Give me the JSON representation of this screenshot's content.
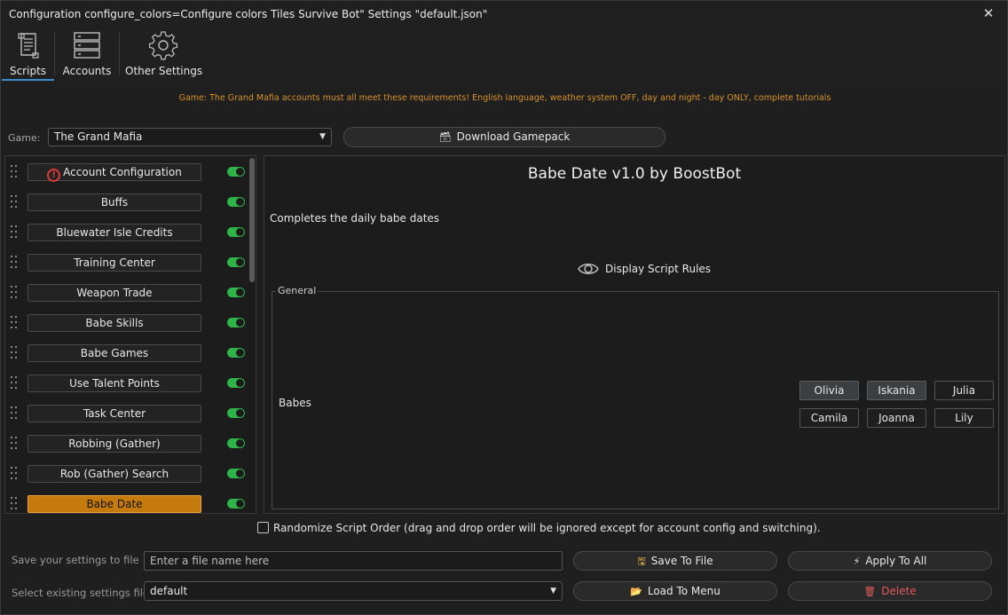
{
  "window": {
    "title": "Configuration configure_colors=Configure colors Tiles Survive Bot\" Settings \"default.json\"",
    "close_icon": "close-icon"
  },
  "toolbar": {
    "tabs": [
      {
        "label": "Scripts",
        "icon": "scroll-icon",
        "active": true
      },
      {
        "label": "Accounts",
        "icon": "server-rack-icon",
        "active": false
      },
      {
        "label": "Other Settings",
        "icon": "gear-icon",
        "active": false
      }
    ]
  },
  "notice": "Game: The Grand Mafia accounts must all meet these requirements! English language, weather system OFF, day and night - day ONLY, complete tutorials",
  "game": {
    "label": "Game:",
    "selected": "The Grand Mafia",
    "download_label": "Download Gamepack"
  },
  "scripts": {
    "items": [
      {
        "label": "Account Configuration",
        "enabled": true,
        "warning": true
      },
      {
        "label": "Buffs",
        "enabled": true
      },
      {
        "label": "Bluewater Isle Credits",
        "enabled": true
      },
      {
        "label": "Training Center",
        "enabled": true
      },
      {
        "label": "Weapon Trade",
        "enabled": true
      },
      {
        "label": "Babe Skills",
        "enabled": true
      },
      {
        "label": "Babe Games",
        "enabled": true
      },
      {
        "label": "Use Talent Points",
        "enabled": true
      },
      {
        "label": "Task Center",
        "enabled": true
      },
      {
        "label": "Robbing (Gather)",
        "enabled": true
      },
      {
        "label": "Rob (Gather) Search",
        "enabled": true
      },
      {
        "label": "Babe Date",
        "enabled": true,
        "selected": true
      }
    ]
  },
  "detail": {
    "title": "Babe Date v1.0 by BoostBot",
    "description": "Completes the daily babe dates",
    "rules_label": "Display Script Rules",
    "group_label": "General",
    "babes_label": "Babes",
    "babes": [
      {
        "name": "Olivia",
        "selected": true
      },
      {
        "name": "Iskania",
        "selected": true
      },
      {
        "name": "Julia",
        "selected": false
      },
      {
        "name": "Camila",
        "selected": false
      },
      {
        "name": "Joanna",
        "selected": false
      },
      {
        "name": "Lily",
        "selected": false
      }
    ]
  },
  "randomize": {
    "label": "Randomize Script Order (drag and drop order will be ignored except for account config and switching).",
    "checked": false
  },
  "save": {
    "label": "Save your settings to file",
    "placeholder": "Enter a file name here",
    "save_button": "Save To File",
    "apply_button": "Apply To All"
  },
  "load": {
    "label": "Select existing settings file",
    "selected": "default",
    "load_button": "Load To Menu",
    "delete_button": "Delete"
  },
  "colors": {
    "accent": "#3b8fd1",
    "selected_script": "#c47a0c",
    "toggle_on": "#2fb44a",
    "notice": "#d9922a",
    "danger": "#e35a5a"
  }
}
